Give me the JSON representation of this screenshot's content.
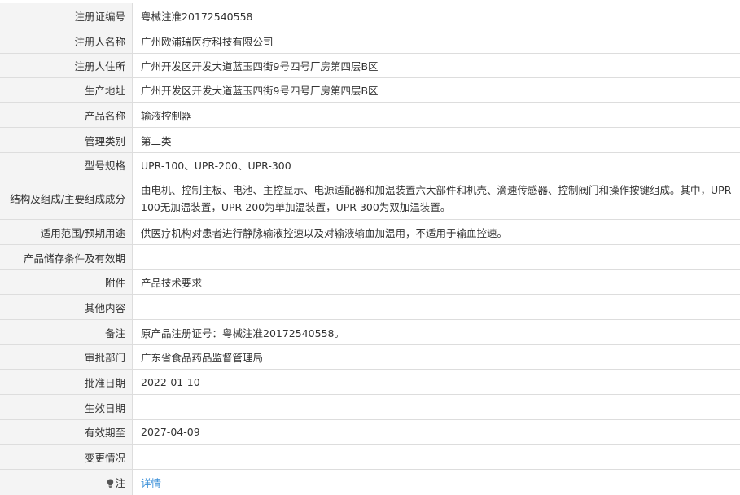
{
  "rows": [
    {
      "label": "注册证编号",
      "value": "粤械注准20172540558"
    },
    {
      "label": "注册人名称",
      "value": "广州欧浦瑞医疗科技有限公司"
    },
    {
      "label": "注册人住所",
      "value": "广州开发区开发大道蓝玉四街9号四号厂房第四层B区"
    },
    {
      "label": "生产地址",
      "value": "广州开发区开发大道蓝玉四街9号四号厂房第四层B区"
    },
    {
      "label": "产品名称",
      "value": "输液控制器"
    },
    {
      "label": "管理类别",
      "value": "第二类"
    },
    {
      "label": "型号规格",
      "value": "UPR-100、UPR-200、UPR-300"
    },
    {
      "label": "结构及组成/主要组成成分",
      "value": "由电机、控制主板、电池、主控显示、电源适配器和加温装置六大部件和机壳、滴速传感器、控制阀门和操作按键组成。其中，UPR-100无加温装置，UPR-200为单加温装置，UPR-300为双加温装置。"
    },
    {
      "label": "适用范围/预期用途",
      "value": "供医疗机构对患者进行静脉输液控速以及对输液输血加温用，不适用于输血控速。"
    },
    {
      "label": "产品储存条件及有效期",
      "value": ""
    },
    {
      "label": "附件",
      "value": "产品技术要求"
    },
    {
      "label": "其他内容",
      "value": ""
    },
    {
      "label": "备注",
      "value": "原产品注册证号：粤械注准20172540558。"
    },
    {
      "label": "审批部门",
      "value": "广东省食品药品监督管理局"
    },
    {
      "label": "批准日期",
      "value": "2022-01-10"
    },
    {
      "label": "生效日期",
      "value": ""
    },
    {
      "label": "有效期至",
      "value": "2027-04-09"
    },
    {
      "label": "变更情况",
      "value": ""
    },
    {
      "label": "注",
      "value": "详情"
    }
  ],
  "colors": {
    "link": "#3a8fd8",
    "label_bg": "#f4f4f4",
    "border": "#dddddd"
  },
  "icons": {
    "note": "lightbulb-icon"
  }
}
